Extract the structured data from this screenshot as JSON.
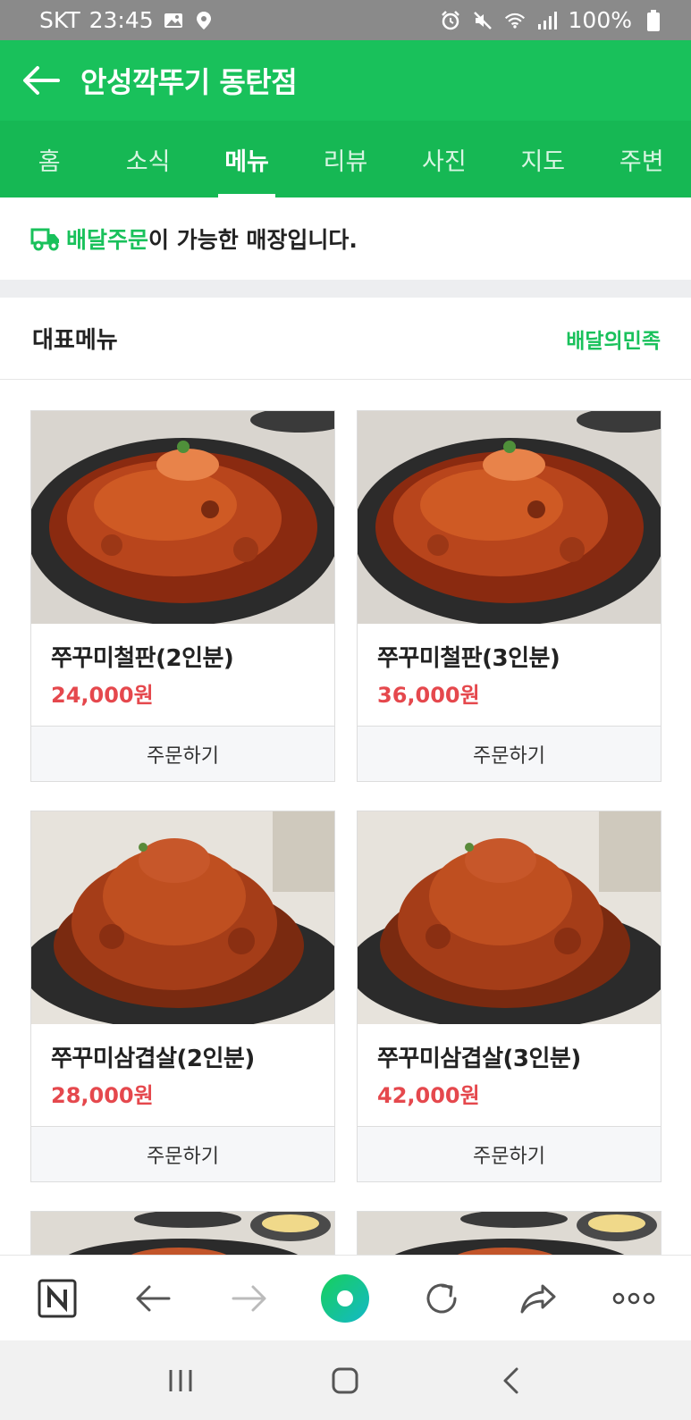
{
  "status_bar": {
    "carrier": "SKT",
    "time": "23:45",
    "battery": "100%",
    "icons": [
      "image-icon",
      "location-icon",
      "alarm-icon",
      "mute-icon",
      "wifi-icon",
      "signal-icon",
      "battery-icon"
    ]
  },
  "header": {
    "title": "안성깍뚜기 동탄점"
  },
  "tabs": [
    {
      "label": "홈"
    },
    {
      "label": "소식"
    },
    {
      "label": "메뉴",
      "active": true
    },
    {
      "label": "리뷰"
    },
    {
      "label": "사진"
    },
    {
      "label": "지도"
    },
    {
      "label": "주변"
    }
  ],
  "notice": {
    "highlight": "배달주문",
    "rest": "이 가능한 매장입니다."
  },
  "section": {
    "title": "대표메뉴",
    "link": "배달의민족"
  },
  "menu_items": [
    {
      "name": "쭈꾸미철판(2인분)",
      "price": "24,000원",
      "order_label": "주문하기"
    },
    {
      "name": "쭈꾸미철판(3인분)",
      "price": "36,000원",
      "order_label": "주문하기"
    },
    {
      "name": "쭈꾸미삼겹살(2인분)",
      "price": "28,000원",
      "order_label": "주문하기"
    },
    {
      "name": "쭈꾸미삼겹살(3인분)",
      "price": "42,000원",
      "order_label": "주문하기"
    }
  ],
  "colors": {
    "brand_green": "#19c15b",
    "price_red": "#e5484d"
  },
  "bottom_toolbar": [
    "naver-home-icon",
    "back-icon",
    "forward-icon",
    "green-dot-icon",
    "refresh-icon",
    "share-icon",
    "more-icon"
  ],
  "system_nav": [
    "recents-icon",
    "home-icon",
    "back-icon"
  ]
}
